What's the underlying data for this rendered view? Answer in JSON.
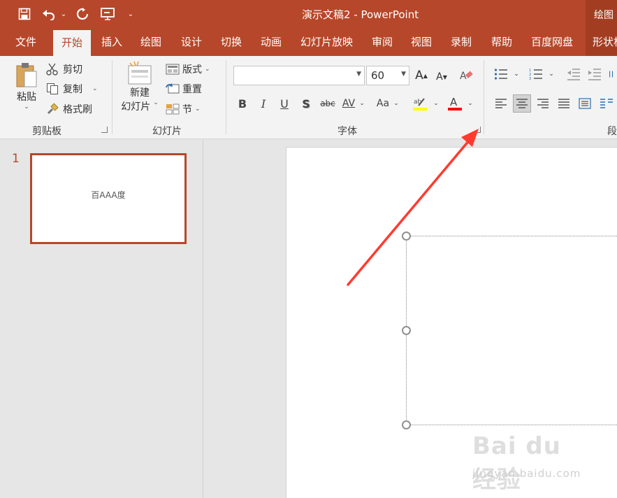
{
  "window": {
    "title": "演示文稿2  -  PowerPoint",
    "context_group": "绘图",
    "quick_access": {
      "customize_symbol": "⌄"
    }
  },
  "tabs": [
    "文件",
    "开始",
    "插入",
    "绘图",
    "设计",
    "切换",
    "动画",
    "幻灯片放映",
    "审阅",
    "视图",
    "录制",
    "帮助",
    "百度网盘",
    "形状格式"
  ],
  "active_tab": "开始",
  "clipboard": {
    "paste": "粘贴",
    "cut": "剪切",
    "copy": "复制",
    "format_painter": "格式刷",
    "group_label": "剪贴板"
  },
  "slides_group": {
    "new_slide_line1": "新建",
    "new_slide_line2": "幻灯片",
    "layout": "版式",
    "reset": "重置",
    "section": "节",
    "group_label": "幻灯片"
  },
  "font_group": {
    "font_name": "",
    "font_size": "60",
    "bold": "B",
    "italic": "I",
    "underline": "U",
    "shadow": "S",
    "strikethrough": "abc",
    "spacing": "AV",
    "change_case": "Aa",
    "highlight_color": "#ffff00",
    "font_color": "#ff0000",
    "group_label": "字体"
  },
  "paragraph_group": {
    "group_label": "段落"
  },
  "slide_pane": {
    "slides": [
      {
        "number": "1",
        "text": "百AAA度"
      }
    ]
  },
  "annotation": {
    "color": "#ff3b30"
  },
  "watermark": {
    "main": "Bai du 经验",
    "sub": "jingyan.baidu.com"
  },
  "colors": {
    "accent": "#b7472a",
    "ribbon_bg": "#f3f3f3",
    "workspace_bg": "#e6e6e6"
  }
}
